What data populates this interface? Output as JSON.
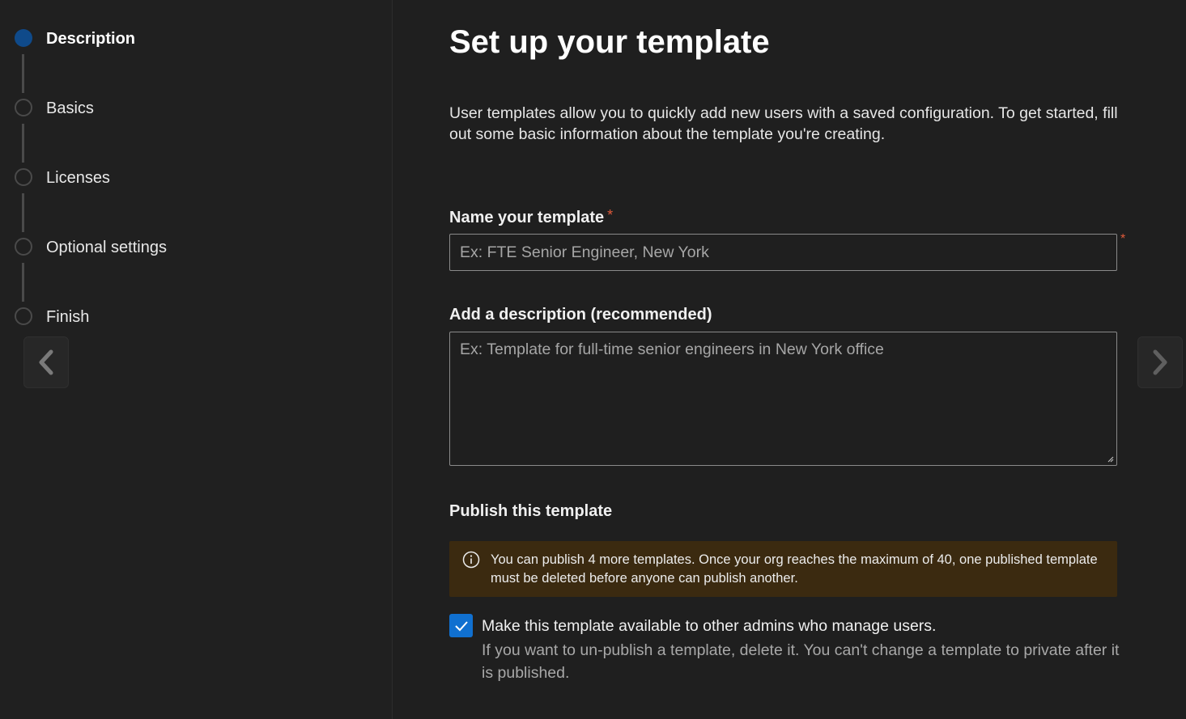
{
  "wizard": {
    "steps": [
      {
        "label": "Description",
        "active": true
      },
      {
        "label": "Basics",
        "active": false
      },
      {
        "label": "Licenses",
        "active": false
      },
      {
        "label": "Optional settings",
        "active": false
      },
      {
        "label": "Finish",
        "active": false
      }
    ],
    "back_icon": "chevron-left-icon",
    "next_icon": "chevron-right-icon"
  },
  "main": {
    "title": "Set up your template",
    "intro": "User templates allow you to quickly add new users with a saved configuration. To get started, fill out some basic information about the template you're creating.",
    "name_field": {
      "label": "Name your template",
      "required_marker": "*",
      "placeholder": "Ex: FTE Senior Engineer, New York",
      "value": ""
    },
    "description_field": {
      "label": "Add a description (recommended)",
      "placeholder": "Ex: Template for full-time senior engineers in New York office",
      "value": ""
    },
    "publish": {
      "heading": "Publish this template",
      "banner_icon": "info-icon",
      "banner_text": "You can publish 4 more templates. Once your org reaches the maximum of 40, one published template must be deleted before anyone can publish another.",
      "checkbox_checked": true,
      "checkbox_label": "Make this template available to other admins who manage users.",
      "checkbox_help": "If you want to un-publish a template, delete it. You can't change a template to private after it is published."
    }
  },
  "colors": {
    "accent": "#1070d0",
    "active_step": "#0f4a8a",
    "required": "#e05a3a",
    "banner_bg": "#3b2a10"
  }
}
